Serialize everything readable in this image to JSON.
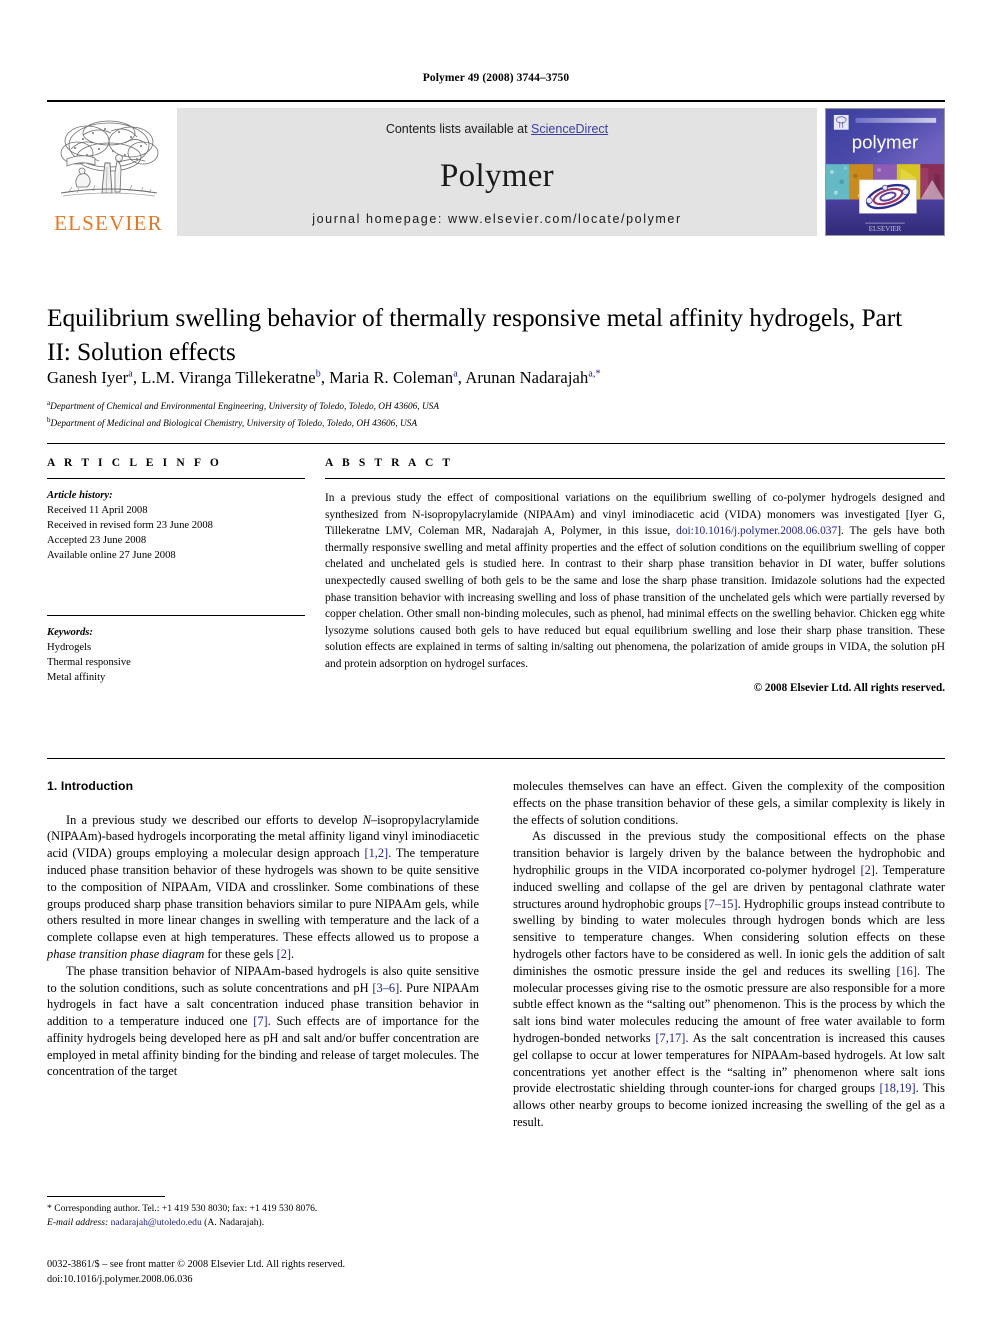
{
  "running_head": "Polymer 49 (2008) 3744–3750",
  "masthead": {
    "publisher_logo_name": "elsevier-tree-logo",
    "publisher_word": "ELSEVIER",
    "contents_prefix": "Contents lists available at ",
    "contents_link": "ScienceDirect",
    "journal_name": "Polymer",
    "homepage": "journal homepage: www.elsevier.com/locate/polymer",
    "cover_title": "polymer",
    "accent_link_color": "#3b3fa0",
    "elsevier_orange": "#e87722",
    "banner_bg": "#e3e3e3"
  },
  "article": {
    "title": "Equilibrium swelling behavior of thermally responsive metal affinity hydrogels, Part II: Solution effects",
    "authors_html": "Ganesh Iyer<sup>a</sup>, L.M. Viranga Tillekeratne<sup>b</sup>, Maria R. Coleman<sup>a</sup>, Arunan Nadarajah<sup>a,</sup><sup>*</sup>",
    "affiliations": [
      "Department of Chemical and Environmental Engineering, University of Toledo, Toledo, OH 43606, USA",
      "Department of Medicinal and Biological Chemistry, University of Toledo, Toledo, OH 43606, USA"
    ],
    "affiliation_marks": [
      "a",
      "b"
    ]
  },
  "article_info": {
    "heading": "A R T I C L E   I N F O",
    "history_label": "Article history:",
    "history": [
      "Received 11 April 2008",
      "Received in revised form 23 June 2008",
      "Accepted 23 June 2008",
      "Available online 27 June 2008"
    ],
    "keywords_label": "Keywords:",
    "keywords": [
      "Hydrogels",
      "Thermal responsive",
      "Metal affinity"
    ]
  },
  "abstract": {
    "heading": "A B S T R A C T",
    "text_html": "In a previous study the effect of compositional variations on the equilibrium swelling of co-polymer hydrogels designed and synthesized from N-isopropylacrylamide (NIPAAm) and vinyl iminodiacetic acid (VIDA) monomers was investigated [Iyer G, Tillekeratne LMV, Coleman MR, Nadarajah A, Polymer, in this issue, <a href=\"#\">doi:10.1016/j.polymer.2008.06.037</a>]. The gels have both thermally responsive swelling and metal affinity properties and the effect of solution conditions on the equilibrium swelling of copper chelated and unchelated gels is studied here. In contrast to their sharp phase transition behavior in DI water, buffer solutions unexpectedly caused swelling of both gels to be the same and lose the sharp phase transition. Imidazole solutions had the expected phase transition behavior with increasing swelling and loss of phase transition of the unchelated gels which were partially reversed by copper chelation. Other small non-binding molecules, such as phenol, had minimal effects on the swelling behavior. Chicken egg white lysozyme solutions caused both gels to have reduced but equal equilibrium swelling and lose their sharp phase transition. These solution effects are explained in terms of salting in/salting out phenomena, the polarization of amide groups in VIDA, the solution pH and protein adsorption on hydrogel surfaces.",
    "copyright": "© 2008 Elsevier Ltd. All rights reserved."
  },
  "body": {
    "section_heading": "1. Introduction",
    "left_paragraphs_html": [
      "In a previous study we described our efforts to develop <em>N</em>–isopropylacrylamide (NIPAAm)-based hydrogels incorporating the metal affinity ligand vinyl iminodiacetic acid (VIDA) groups employing a molecular design approach <span class=\"ref\">[1,2]</span>. The temperature induced phase transition behavior of these hydrogels was shown to be quite sensitive to the composition of NIPAAm, VIDA and crosslinker. Some combinations of these groups produced sharp phase transition behaviors similar to pure NIPAAm gels, while others resulted in more linear changes in swelling with temperature and the lack of a complete collapse even at high temperatures. These effects allowed us to propose a <em>phase transition phase diagram</em> for these gels <span class=\"ref\">[2]</span>.",
      "The phase transition behavior of NIPAAm-based hydrogels is also quite sensitive to the solution conditions, such as solute concentrations and pH <span class=\"ref\">[3–6]</span>. Pure NIPAAm hydrogels in fact have a salt concentration induced phase transition behavior in addition to a temperature induced one <span class=\"ref\">[7]</span>. Such effects are of importance for the affinity hydrogels being developed here as pH and salt and/or buffer concentration are employed in metal affinity binding for the binding and release of target molecules. The concentration of the target"
    ],
    "right_paragraphs_html": [
      "molecules themselves can have an effect. Given the complexity of the composition effects on the phase transition behavior of these gels, a similar complexity is likely in the effects of solution conditions.",
      "As discussed in the previous study the compositional effects on the phase transition behavior is largely driven by the balance between the hydrophobic and hydrophilic groups in the VIDA incorporated co-polymer hydrogel <span class=\"ref\">[2]</span>. Temperature induced swelling and collapse of the gel are driven by pentagonal clathrate water structures around hydrophobic groups <span class=\"ref\">[7–15]</span>. Hydrophilic groups instead contribute to swelling by binding to water molecules through hydrogen bonds which are less sensitive to temperature changes. When considering solution effects on these hydrogels other factors have to be considered as well. In ionic gels the addition of salt diminishes the osmotic pressure inside the gel and reduces its swelling <span class=\"ref\">[16]</span>. The molecular processes giving rise to the osmotic pressure are also responsible for a more subtle effect known as the “salting out” phenomenon. This is the process by which the salt ions bind water molecules reducing the amount of free water available to form hydrogen-bonded networks <span class=\"ref\">[7,17]</span>. As the salt concentration is increased this causes gel collapse to occur at lower temperatures for NIPAAm-based hydrogels. At low salt concentrations yet another effect is the “salting in” phenomenon where salt ions provide electrostatic shielding through counter-ions for charged groups <span class=\"ref\">[18,19]</span>. This allows other nearby groups to become ionized increasing the swelling of the gel as a result."
    ]
  },
  "footnote": {
    "corresponding_html": "* Corresponding author. Tel.: +1 419 530 8030; fax: +1 419 530 8076.",
    "email_label": "E-mail address:",
    "email": "nadarajah@utoledo.edu",
    "email_suffix": "(A. Nadarajah)."
  },
  "page_footer": {
    "front_matter": "0032-3861/$ – see front matter © 2008 Elsevier Ltd. All rights reserved.",
    "doi": "doi:10.1016/j.polymer.2008.06.036"
  }
}
